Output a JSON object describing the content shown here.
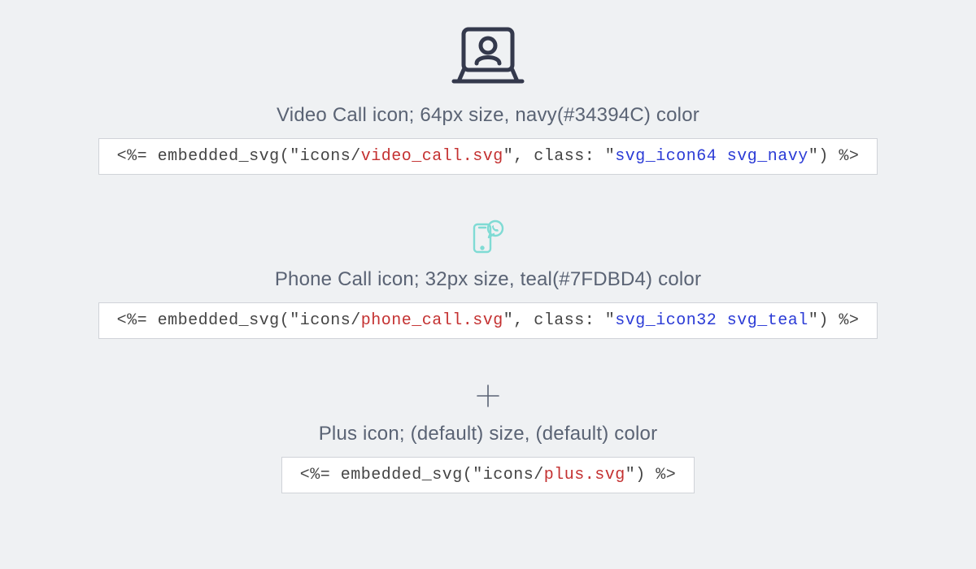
{
  "examples": [
    {
      "icon_name": "video-call-icon",
      "icon_size": 90,
      "icon_color": "#34394C",
      "caption": "Video Call icon; 64px size, navy(#34394C) color",
      "code": {
        "prefix": "<%= embedded_svg(\"icons/",
        "red": "video_call.svg",
        "mid": "\", class: \"",
        "blue": "svg_icon64 svg_navy",
        "suffix": "\") %>"
      }
    },
    {
      "icon_name": "phone-call-icon",
      "icon_size": 40,
      "icon_color": "#7FDBD4",
      "caption": "Phone Call icon; 32px size, teal(#7FDBD4) color",
      "code": {
        "prefix": "<%= embedded_svg(\"icons/",
        "red": "phone_call.svg",
        "mid": "\", class: \"",
        "blue": "svg_icon32 svg_teal",
        "suffix": "\") %>"
      }
    },
    {
      "icon_name": "plus-icon",
      "icon_size": 30,
      "icon_color": "#5a6374",
      "caption": "Plus icon; (default) size, (default) color",
      "code": {
        "prefix": "<%= embedded_svg(\"icons/",
        "red": "plus.svg",
        "mid": "",
        "blue": "",
        "suffix": "\") %>"
      }
    }
  ]
}
